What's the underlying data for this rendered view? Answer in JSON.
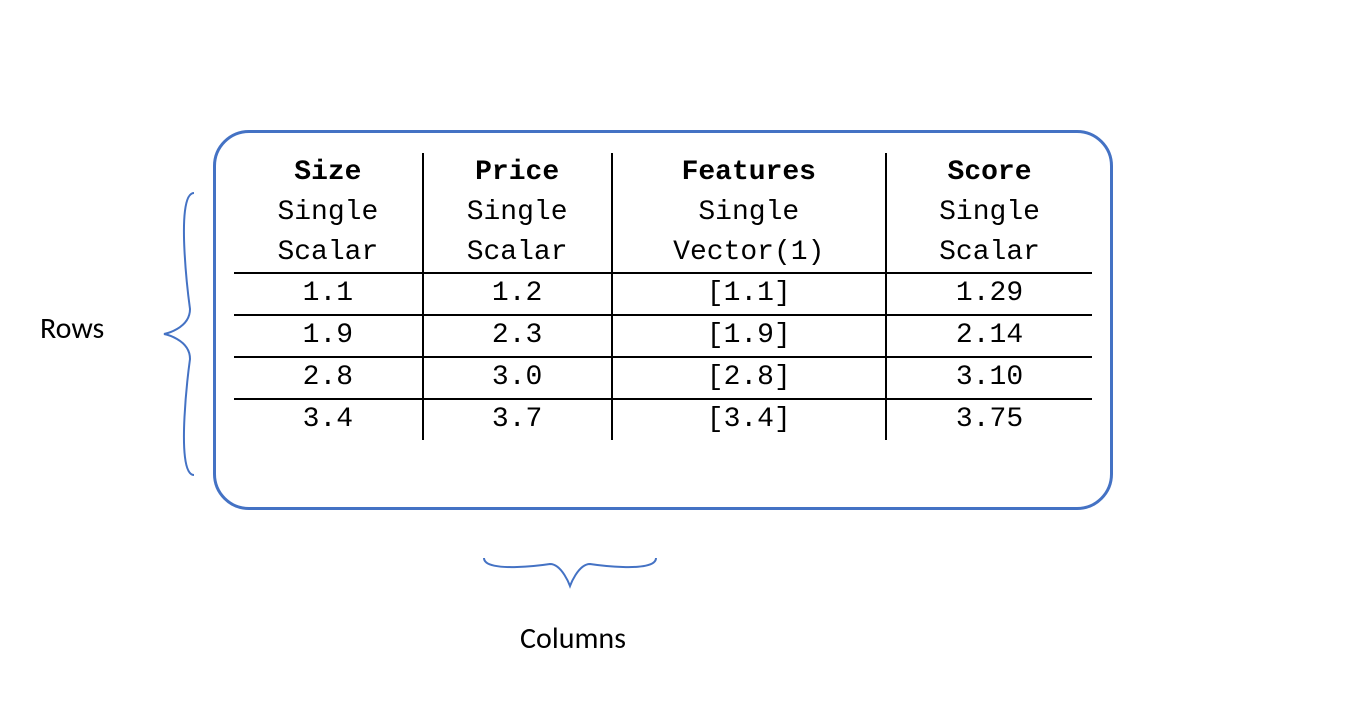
{
  "labels": {
    "rows": "Rows",
    "columns": "Columns"
  },
  "table": {
    "columns": [
      {
        "name": "Size",
        "line2": "Single",
        "line3": "Scalar"
      },
      {
        "name": "Price",
        "line2": "Single",
        "line3": "Scalar"
      },
      {
        "name": "Features",
        "line2": "Single",
        "line3": "Vector(1)"
      },
      {
        "name": "Score",
        "line2": "Single",
        "line3": "Scalar"
      }
    ],
    "rows": [
      {
        "size": "1.1",
        "price": "1.2",
        "features": "[1.1]",
        "score": "1.29"
      },
      {
        "size": "1.9",
        "price": "2.3",
        "features": "[1.9]",
        "score": "2.14"
      },
      {
        "size": "2.8",
        "price": "3.0",
        "features": "[2.8]",
        "score": "3.10"
      },
      {
        "size": "3.4",
        "price": "3.7",
        "features": "[3.4]",
        "score": "3.75"
      }
    ]
  },
  "chart_data": {
    "type": "table",
    "title": "",
    "columns": [
      "Size",
      "Price",
      "Features",
      "Score"
    ],
    "column_types": [
      "Single Scalar",
      "Single Scalar",
      "Single Vector(1)",
      "Single Scalar"
    ],
    "rows": [
      [
        1.1,
        1.2,
        [
          1.1
        ],
        1.29
      ],
      [
        1.9,
        2.3,
        [
          1.9
        ],
        2.14
      ],
      [
        2.8,
        3.0,
        [
          2.8
        ],
        3.1
      ],
      [
        3.4,
        3.7,
        [
          3.4
        ],
        3.75
      ]
    ]
  }
}
